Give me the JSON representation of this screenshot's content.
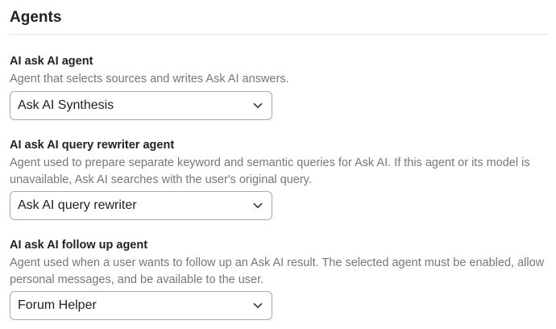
{
  "section": {
    "title": "Agents"
  },
  "settings": [
    {
      "label": "AI ask AI agent",
      "description": "Agent that selects sources and writes Ask AI answers.",
      "selected": "Ask AI Synthesis"
    },
    {
      "label": "AI ask AI query rewriter agent",
      "description": "Agent used to prepare separate keyword and semantic queries for Ask AI. If this agent or its model is unavailable, Ask AI searches with the user's original query.",
      "selected": "Ask AI query rewriter"
    },
    {
      "label": "AI ask AI follow up agent",
      "description": "Agent used when a user wants to follow up an Ask AI result. The selected agent must be enabled, allow personal messages, and be available to the user.",
      "selected": "Forum Helper"
    }
  ],
  "icons": {
    "dropdown": "chevron-down-icon"
  },
  "colors": {
    "text": "#222222",
    "muted": "#777777",
    "border": "#a8a8a8",
    "divider": "#e4e4e4"
  }
}
